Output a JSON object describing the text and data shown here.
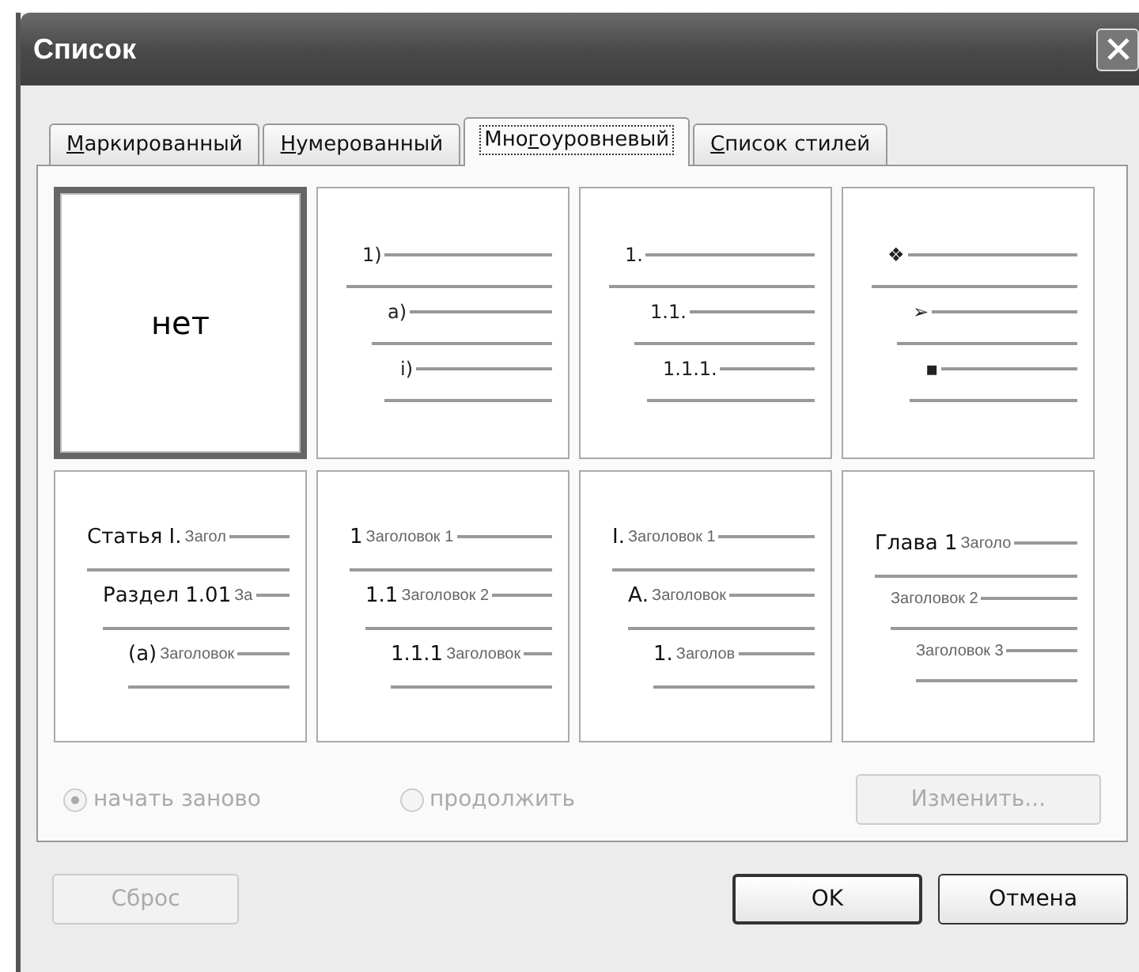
{
  "window": {
    "title": "Список"
  },
  "tabs": [
    {
      "label": {
        "key": "М",
        "after": "аркированный"
      },
      "selected": false
    },
    {
      "label": {
        "key": "Н",
        "after": "умерованный"
      },
      "selected": false
    },
    {
      "label": {
        "before": "Мно",
        "key": "г",
        "after": "оуровневый"
      },
      "selected": true
    },
    {
      "label": {
        "key": "С",
        "after": "писок стилей"
      },
      "selected": false
    }
  ],
  "gallery": [
    {
      "kind": "none",
      "text": "нет",
      "selected": true
    },
    {
      "kind": "list",
      "selected": false,
      "levels": [
        {
          "number": "1)",
          "children": [
            {
              "number": "a)",
              "children": [
                {
                  "number": "i)"
                }
              ]
            }
          ]
        }
      ]
    },
    {
      "kind": "list",
      "selected": false,
      "levels": [
        {
          "number": "1.",
          "children": [
            {
              "number": "1.1.",
              "children": [
                {
                  "number": "1.1.1."
                }
              ]
            }
          ]
        }
      ]
    },
    {
      "kind": "list",
      "selected": false,
      "levels": [
        {
          "number": "❖",
          "children": [
            {
              "number": "➢",
              "children": [
                {
                  "number": "▪"
                }
              ]
            }
          ]
        }
      ]
    },
    {
      "kind": "headings",
      "selected": false,
      "levels": [
        {
          "number": "Статья I.",
          "heading": "Загол",
          "children": [
            {
              "number": "Раздел 1.01",
              "heading": "За",
              "children": [
                {
                  "number": "(а)",
                  "heading": "Заголовок"
                }
              ]
            }
          ]
        }
      ]
    },
    {
      "kind": "headings",
      "selected": false,
      "levels": [
        {
          "number": "1",
          "heading": "Заголовок 1",
          "children": [
            {
              "number": "1.1",
              "heading": "Заголовок 2",
              "children": [
                {
                  "number": "1.1.1",
                  "heading": "Заголовок"
                }
              ]
            }
          ]
        }
      ]
    },
    {
      "kind": "headings",
      "selected": false,
      "levels": [
        {
          "number": "I.",
          "heading": "Заголовок 1",
          "children": [
            {
              "number": "А.",
              "heading": "Заголовок",
              "children": [
                {
                  "number": "1.",
                  "heading": "Заголов"
                }
              ]
            }
          ]
        }
      ]
    },
    {
      "kind": "headings",
      "selected": false,
      "levels": [
        {
          "number": "Глава 1",
          "heading": "Заголо",
          "children": [
            {
              "heading": "Заголовок 2",
              "children": [
                {
                  "heading": "Заголовок 3"
                }
              ]
            }
          ]
        }
      ]
    }
  ],
  "numbering": [
    {
      "label": "начать заново",
      "selected": true,
      "disabled": true
    },
    {
      "label": "продолжить",
      "selected": false,
      "disabled": true
    }
  ],
  "modify_button": {
    "label": "Изменить...",
    "disabled": true
  },
  "buttons": [
    {
      "label": "Сброс",
      "kind": "reset",
      "disabled": true
    },
    {
      "label": "OK",
      "kind": "default",
      "disabled": false
    },
    {
      "label": "Отмена",
      "kind": "normal",
      "disabled": false
    }
  ]
}
